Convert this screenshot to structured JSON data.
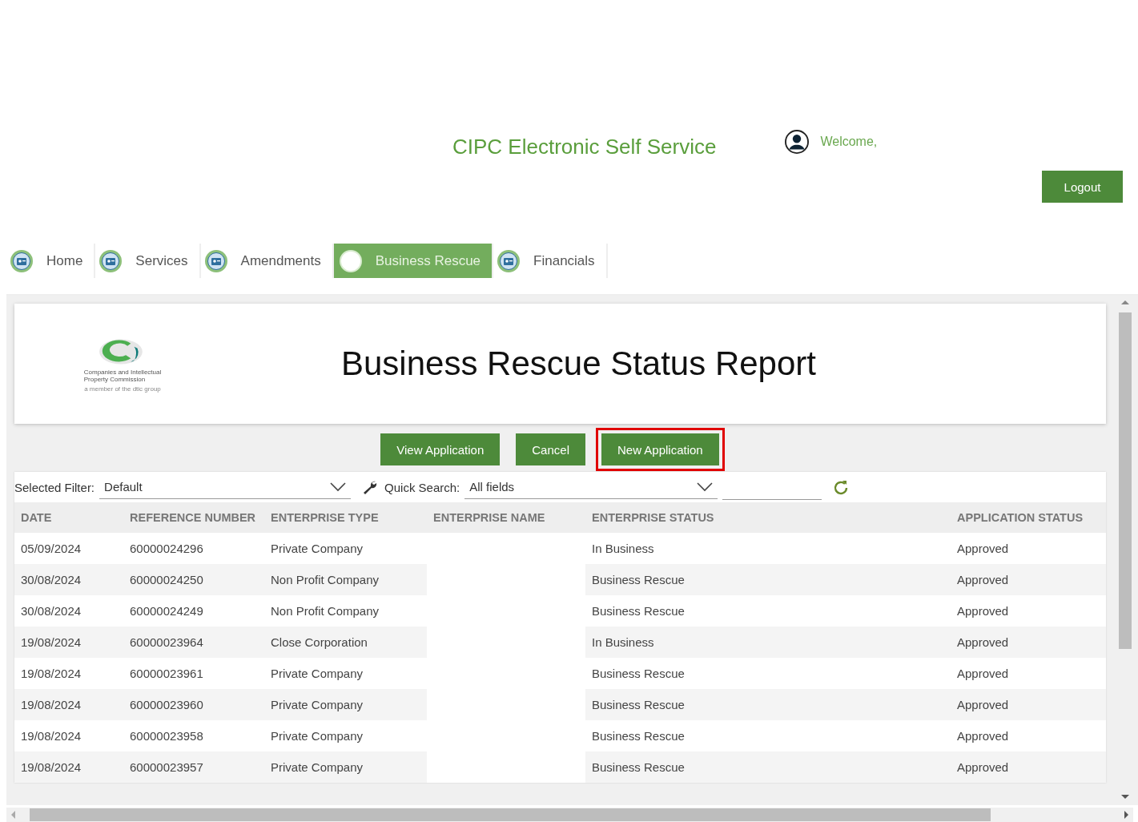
{
  "header": {
    "title": "CIPC Electronic Self Service",
    "welcome": "Welcome,",
    "logout": "Logout"
  },
  "nav": [
    {
      "label": "Home",
      "selected": false
    },
    {
      "label": "Services",
      "selected": false
    },
    {
      "label": "Amendments",
      "selected": false
    },
    {
      "label": "Business Rescue",
      "selected": true
    },
    {
      "label": "Financials",
      "selected": false
    }
  ],
  "report": {
    "logo_lines": [
      "Companies and Intellectual",
      "Property Commission"
    ],
    "logo_tagline": "a member of the dtic group",
    "title": "Business Rescue Status Report"
  },
  "actions": [
    {
      "label": "View Application",
      "highlighted": false
    },
    {
      "label": "Cancel",
      "highlighted": false
    },
    {
      "label": "New Application",
      "highlighted": true
    }
  ],
  "filter": {
    "label": "Selected Filter:",
    "value": "Default",
    "search_label": "Quick Search:",
    "search_scope": "All fields"
  },
  "table": {
    "columns": [
      "DATE",
      "REFERENCE NUMBER",
      "ENTERPRISE TYPE",
      "ENTERPRISE NAME",
      "ENTERPRISE STATUS",
      "APPLICATION STATUS"
    ],
    "rows": [
      [
        "05/09/2024",
        "60000024296",
        "Private Company",
        "",
        "In Business",
        "Approved"
      ],
      [
        "30/08/2024",
        "60000024250",
        "Non Profit Company",
        "",
        "Business Rescue",
        "Approved"
      ],
      [
        "30/08/2024",
        "60000024249",
        "Non Profit Company",
        "",
        "Business Rescue",
        "Approved"
      ],
      [
        "19/08/2024",
        "60000023964",
        "Close Corporation",
        "",
        "In Business",
        "Approved"
      ],
      [
        "19/08/2024",
        "60000023961",
        "Private Company",
        "",
        "Business Rescue",
        "Approved"
      ],
      [
        "19/08/2024",
        "60000023960",
        "Private Company",
        "",
        "Business Rescue",
        "Approved"
      ],
      [
        "19/08/2024",
        "60000023958",
        "Private Company",
        "",
        "Business Rescue",
        "Approved"
      ],
      [
        "19/08/2024",
        "60000023957",
        "Private Company",
        "",
        "Business Rescue",
        "Approved"
      ]
    ]
  }
}
